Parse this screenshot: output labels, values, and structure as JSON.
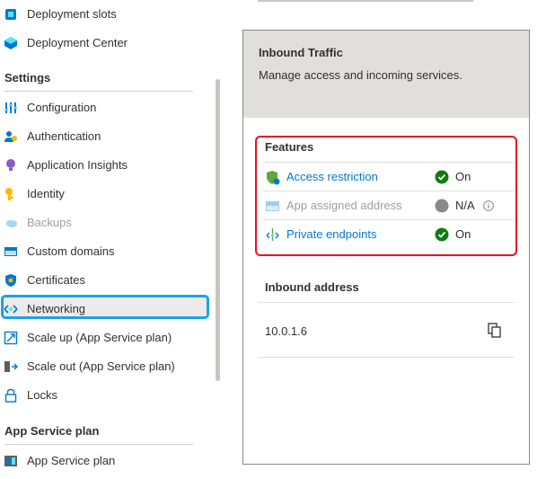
{
  "sidebar": {
    "items": [
      {
        "label": "Deployment slots",
        "icon": "deployment-slots-icon"
      },
      {
        "label": "Deployment Center",
        "icon": "deployment-center-icon"
      },
      {
        "label": "Configuration",
        "icon": "configuration-icon"
      },
      {
        "label": "Authentication",
        "icon": "authentication-icon"
      },
      {
        "label": "Application Insights",
        "icon": "application-insights-icon"
      },
      {
        "label": "Identity",
        "icon": "identity-icon"
      },
      {
        "label": "Backups",
        "icon": "backups-icon"
      },
      {
        "label": "Custom domains",
        "icon": "custom-domains-icon"
      },
      {
        "label": "Certificates",
        "icon": "certificates-icon"
      },
      {
        "label": "Networking",
        "icon": "networking-icon"
      },
      {
        "label": "Scale up (App Service plan)",
        "icon": "scale-up-icon"
      },
      {
        "label": "Scale out (App Service plan)",
        "icon": "scale-out-icon"
      },
      {
        "label": "Locks",
        "icon": "lock-icon"
      },
      {
        "label": "App Service plan",
        "icon": "app-service-plan-icon"
      }
    ],
    "sections": {
      "settings": "Settings",
      "app_service_plan": "App Service plan"
    },
    "selected": "Networking"
  },
  "panel": {
    "title": "Inbound Traffic",
    "subtitle": "Manage access and incoming services.",
    "features_title": "Features",
    "features": [
      {
        "name": "Access restriction",
        "status": "On",
        "status_color": "#107c10"
      },
      {
        "name": "App assigned address",
        "status": "N/A",
        "status_color": "#8a8886"
      },
      {
        "name": "Private endpoints",
        "status": "On",
        "status_color": "#107c10"
      }
    ],
    "inbound_address_title": "Inbound address",
    "inbound_address_value": "10.0.1.6"
  },
  "colors": {
    "accent": "#0078d4",
    "highlight": "#1aa3e8",
    "red_outline": "#e81123"
  }
}
